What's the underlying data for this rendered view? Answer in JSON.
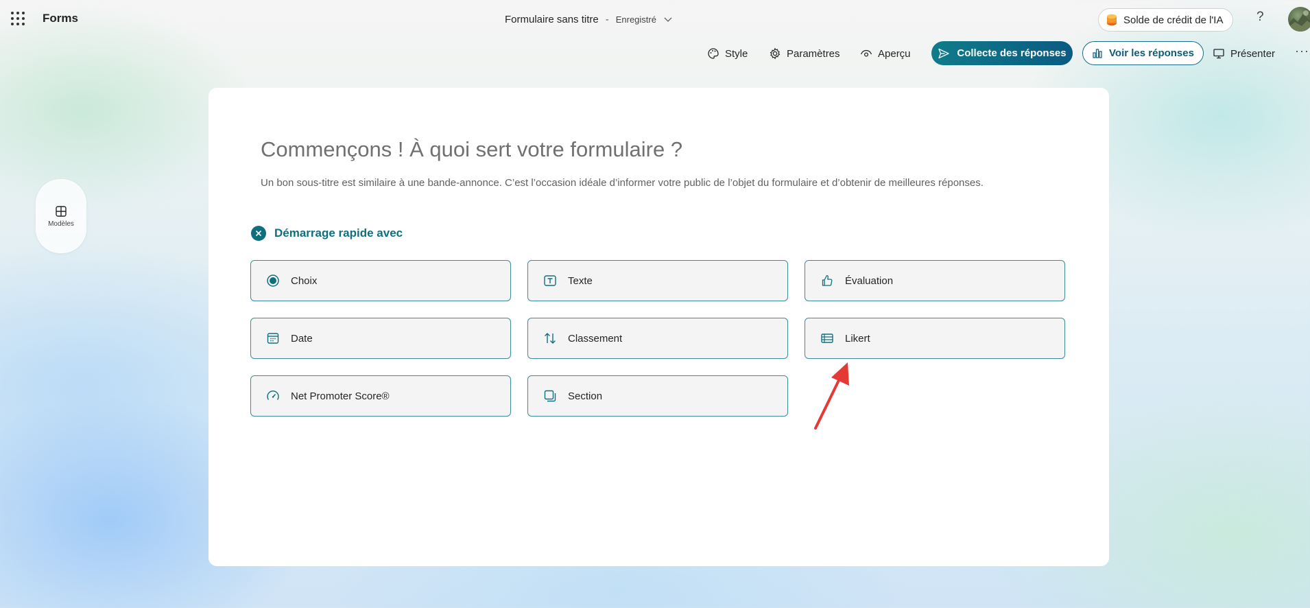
{
  "app": {
    "name": "Forms"
  },
  "document": {
    "title": "Formulaire sans titre",
    "separator": "-",
    "status": "Enregistré"
  },
  "header": {
    "credit_label": "Solde de crédit de l'IA",
    "help_label": "?",
    "more_label": "···"
  },
  "toolbar": {
    "style_label": "Style",
    "settings_label": "Paramètres",
    "preview_label": "Aperçu",
    "collect_label": "Collecte des réponses",
    "view_responses_label": "Voir les réponses",
    "present_label": "Présenter"
  },
  "sidebar": {
    "templates_label": "Modèles"
  },
  "form": {
    "title": "Commençons ! À quoi sert votre formulaire ?",
    "subtitle": "Un bon sous-titre est similaire à une bande-annonce. C’est l’occasion idéale d’informer votre public de l’objet du formulaire et d’obtenir de meilleures réponses."
  },
  "quick_start": {
    "label": "Démarrage rapide avec",
    "question_types": [
      {
        "label": "Choix",
        "icon": "radio-icon"
      },
      {
        "label": "Texte",
        "icon": "text-icon"
      },
      {
        "label": "Évaluation",
        "icon": "thumbs-up-icon"
      },
      {
        "label": "Date",
        "icon": "calendar-icon"
      },
      {
        "label": "Classement",
        "icon": "ranking-icon"
      },
      {
        "label": "Likert",
        "icon": "likert-icon"
      },
      {
        "label": "Net Promoter Score®",
        "icon": "gauge-icon"
      },
      {
        "label": "Section",
        "icon": "section-icon"
      }
    ]
  },
  "colors": {
    "accent": "#0f6f7e",
    "collect_gradient_start": "#0f7c8a",
    "collect_gradient_end": "#0b5a82",
    "card_border": "#3c8c99",
    "annotation_arrow": "#e53935"
  }
}
